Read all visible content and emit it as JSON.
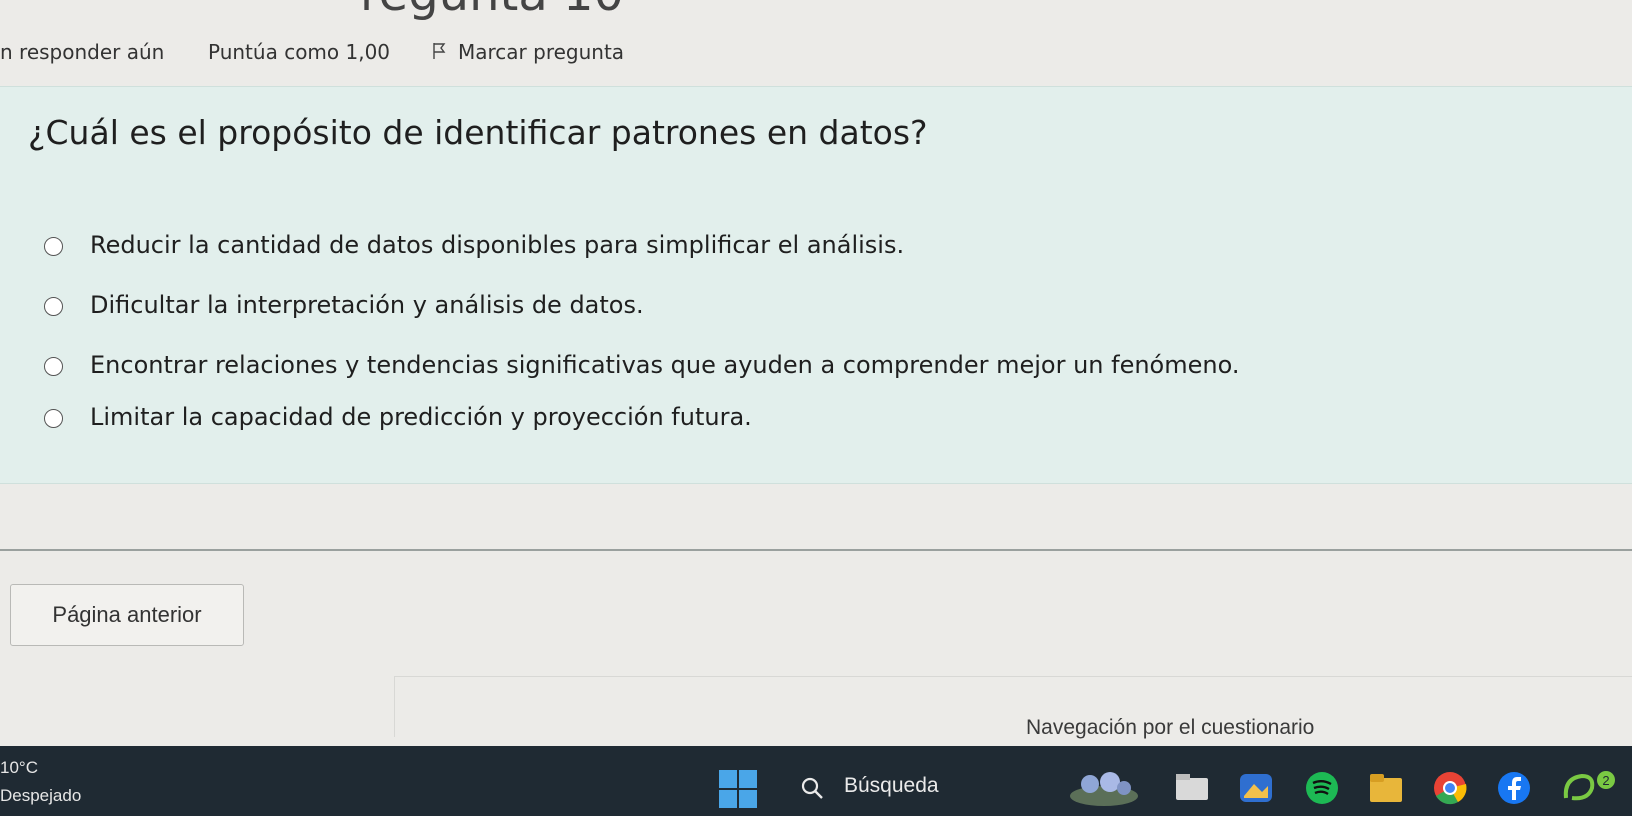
{
  "header": {
    "title_partial": "regunta 10",
    "status": "n responder aún",
    "score": "Puntúa como 1,00",
    "flag_label": "Marcar pregunta"
  },
  "question": {
    "text": "¿Cuál es el propósito de identificar patrones en datos?",
    "options": [
      "Reducir la cantidad de datos disponibles para simplificar el análisis.",
      "Dificultar la interpretación y análisis de datos.",
      "Encontrar relaciones y tendencias significativas que ayuden a comprender mejor un fenómeno.",
      "Limitar la capacidad de predicción y proyección futura."
    ]
  },
  "navigation": {
    "prev_button": "Página anterior",
    "quiz_nav_title": "Navegación por el cuestionario"
  },
  "taskbar": {
    "temperature": "10°C",
    "weather": "Despejado",
    "search_label": "Búsqueda",
    "badge_count": "2",
    "apps": [
      "windows-start",
      "widgets",
      "file-explorer",
      "photos",
      "spotify",
      "files",
      "chrome",
      "facebook",
      "snipping"
    ],
    "colors": {
      "taskbar": "#1f2a33",
      "question_bg": "#e2efec",
      "accent_blue": "#4aa6e8"
    }
  }
}
